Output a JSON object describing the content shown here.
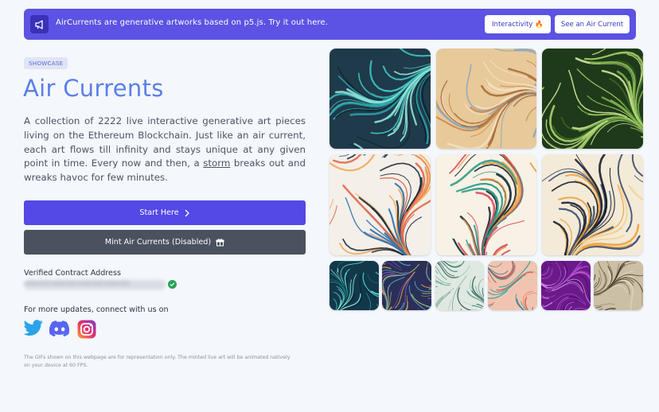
{
  "banner": {
    "text": "AirCurrents are generative artworks based on p5.js. Try it out here.",
    "interactivity_label": "Interactivity",
    "interactivity_emoji": "🔥",
    "see_label": "See an Air Current"
  },
  "hero": {
    "badge": "SHOWCASE",
    "title": "Air Currents",
    "desc_before": "A collection of 2222 live interactive generative art pieces living on the Ethereum Blockchain. Just like an air current, each art flows till infinity and stays unique at any given point in time. Every now and then, a ",
    "desc_link": "storm",
    "desc_after": " breaks out and wreaks havoc for few minutes."
  },
  "actions": {
    "start_label": "Start Here",
    "mint_label": "Mint Air Currents (Disabled)"
  },
  "contract": {
    "label": "Verified Contract Address",
    "value": "redacted-redacted-redacted-redacted"
  },
  "social": {
    "heading": "For more updates, connect with us on",
    "items": [
      "twitter-icon",
      "discord-icon",
      "instagram-icon"
    ]
  },
  "footnote": "The GIFs shown on this webpage are for representation only. The minted live art will be animated natively on your device at 60 FPS.",
  "colors": {
    "accent": "#5448e6",
    "title": "#5b7fe8",
    "mint_disabled": "#4a525f",
    "verified": "#27a35a"
  },
  "gallery": {
    "tiles": [
      {
        "bg": "#1f3a4a",
        "lines": [
          "#3fc3c0",
          "#8fe6d8",
          "#2a9fa5",
          "#0e2632"
        ]
      },
      {
        "bg": "#e8c99a",
        "lines": [
          "#c98a4a",
          "#8aa6c0",
          "#f2e0bf",
          "#a86b3a"
        ]
      },
      {
        "bg": "#1f3a1a",
        "lines": [
          "#7db04a",
          "#a7d36b",
          "#3e6b25",
          "#cfe59a"
        ]
      },
      {
        "bg": "#f4efe8",
        "lines": [
          "#e0684a",
          "#2a6fa8",
          "#f0a85a",
          "#1d2a3a"
        ]
      },
      {
        "bg": "#f7f1e6",
        "lines": [
          "#2f9a8a",
          "#e6a04a",
          "#d9485a",
          "#1c2530"
        ]
      },
      {
        "bg": "#f3ead8",
        "lines": [
          "#1a1f2e",
          "#f0a23a",
          "#f6d59a",
          "#3a4a6a"
        ]
      },
      {
        "bg": "#12384a",
        "lines": [
          "#3fd0c8",
          "#8ef0e0",
          "#1a7a80",
          "#0a2030"
        ]
      },
      {
        "bg": "#2a2f58",
        "lines": [
          "#e0a050",
          "#4fb0c8",
          "#7a5ab0",
          "#c8d060"
        ]
      },
      {
        "bg": "#dfe9e2",
        "lines": [
          "#3a7a6a",
          "#7ab0a0",
          "#b8d6c8",
          "#1e4a40"
        ]
      },
      {
        "bg": "#f0c4b0",
        "lines": [
          "#2aa0a0",
          "#e05a4a",
          "#f4e0c8",
          "#4a6a8a"
        ]
      },
      {
        "bg": "#6a1a8a",
        "lines": [
          "#b04ad0",
          "#e08af0",
          "#3a0a5a",
          "#d060e0"
        ]
      },
      {
        "bg": "#cbbfa6",
        "lines": [
          "#3a3226",
          "#8a7a5a",
          "#e8dcc0",
          "#5a4e3a"
        ]
      }
    ]
  }
}
